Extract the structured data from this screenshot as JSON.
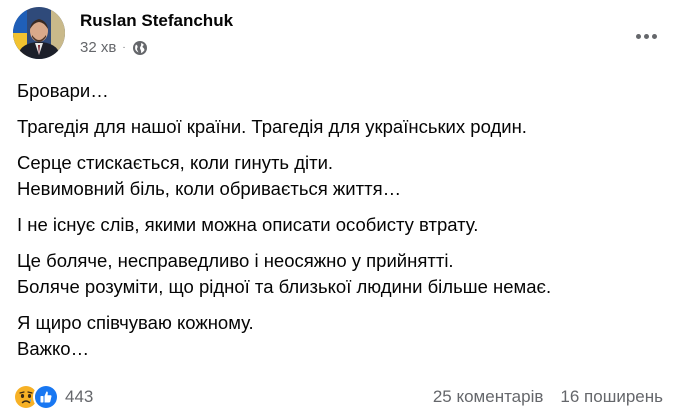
{
  "post": {
    "author": "Ruslan Stefanchuk",
    "time": "32 хв",
    "separator": "·",
    "privacy_icon": "globe-icon",
    "more_icon": "more-horizontal-icon",
    "paragraphs": [
      [
        "Бровари…"
      ],
      [
        "Трагедія для нашої країни. Трагедія для українських родин."
      ],
      [
        "Серце стискається, коли гинуть діти.",
        "Невимовний біль, коли обривається життя…"
      ],
      [
        "І не існує слів, якими можна описати особисту втрату."
      ],
      [
        "Це боляче, несправедливо і неосяжно у прийнятті.",
        "Боляче розуміти, що рідної та близької людини більше немає."
      ],
      [
        "Я щиро співчуваю кожному.",
        "Важко…"
      ]
    ],
    "reactions": {
      "icons": [
        "sad-reaction-icon",
        "like-reaction-icon"
      ],
      "count": "443"
    },
    "comments": "25 коментарів",
    "shares": "16 поширень"
  },
  "colors": {
    "text": "#050505",
    "secondary_text": "#65676b",
    "like_blue": "#1877f2",
    "sad_yellow": "#f7b125"
  }
}
